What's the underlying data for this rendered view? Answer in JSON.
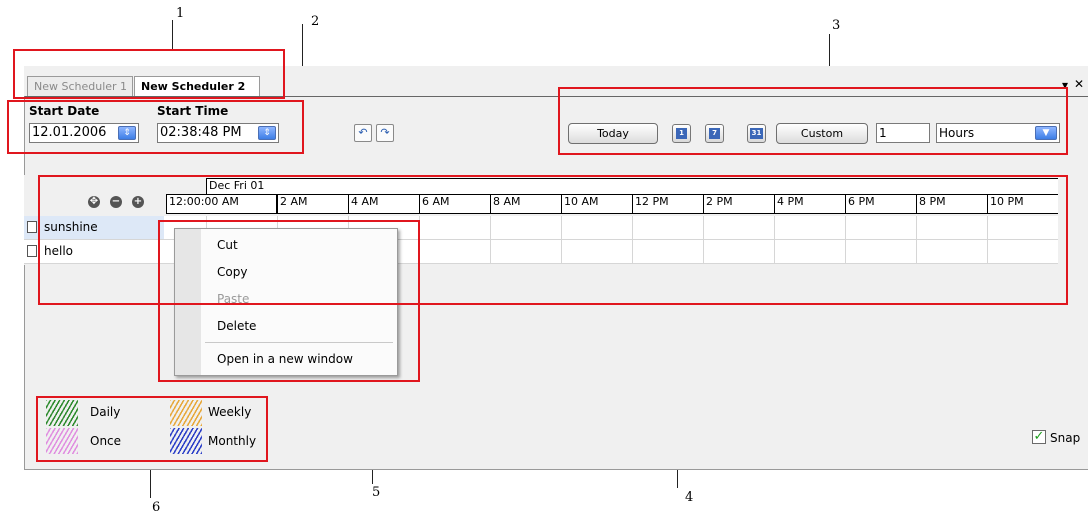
{
  "callouts": [
    "1",
    "2",
    "3",
    "4",
    "5",
    "6"
  ],
  "tabs": [
    {
      "label": "New Scheduler 1",
      "active": false
    },
    {
      "label": "New Scheduler 2",
      "active": true
    }
  ],
  "window_controls": {
    "menu_glyph": "▾",
    "close_glyph": "✕"
  },
  "start": {
    "date_label": "Start Date",
    "date_value": "12.01.2006",
    "time_label": "Start Time",
    "time_value": "02:38:48 PM"
  },
  "history": {
    "undo_icon": "undo-icon",
    "redo_icon": "redo-icon"
  },
  "view_toolbar": {
    "today": "Today",
    "day_icon": "1",
    "week_icon": "7",
    "month_icon": "31",
    "custom": "Custom",
    "amount": "1",
    "unit": "Hours"
  },
  "timeline": {
    "date_header": "Dec Fri 01",
    "start_time": "12:00:00 AM",
    "hours": [
      "2 AM",
      "4 AM",
      "6 AM",
      "8 AM",
      "10 AM",
      "12 PM",
      "2 PM",
      "4 PM",
      "6 PM",
      "8 PM",
      "10 PM"
    ],
    "zoom_controls": [
      "move-icon",
      "zoom-out-icon",
      "zoom-in-icon"
    ]
  },
  "rows": [
    {
      "label": "sunshine",
      "selected": true
    },
    {
      "label": "hello",
      "selected": false
    }
  ],
  "context_menu": [
    {
      "label": "Cut",
      "enabled": true
    },
    {
      "label": "Copy",
      "enabled": true
    },
    {
      "label": "Paste",
      "enabled": false
    },
    {
      "label": "Delete",
      "enabled": true
    },
    {
      "label": "Open in a new window",
      "enabled": true
    }
  ],
  "legend": [
    {
      "label": "Daily",
      "color": "#2e8b2e"
    },
    {
      "label": "Weekly",
      "color": "#e7a83a"
    },
    {
      "label": "Once",
      "color": "#e08ee0"
    },
    {
      "label": "Monthly",
      "color": "#2b3fc8"
    }
  ],
  "snap": {
    "label": "Snap",
    "checked": true
  },
  "colors": {
    "annotation_red": "#e0161e",
    "spin_blue": "#3d7ee6"
  }
}
